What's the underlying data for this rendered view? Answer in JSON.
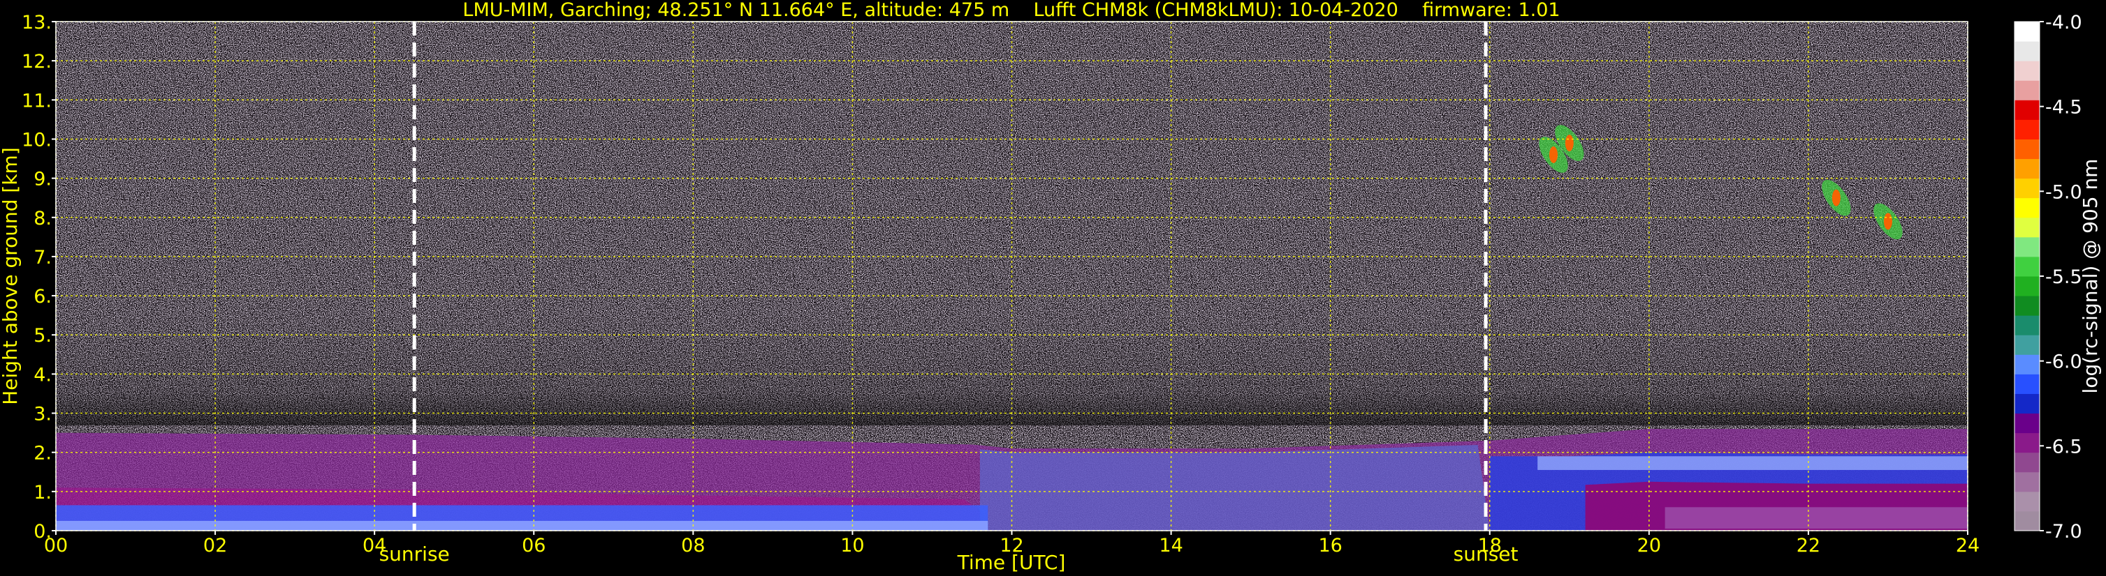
{
  "chart_data": {
    "type": "heatmap",
    "title": "LMU-MIM, Garching; 48.251° N 11.664° E, altitude: 475 m    Lufft CHM8k (CHM8kLMU): 10-04-2020    firmware: 1.01",
    "xlabel": "Time [UTC]",
    "ylabel": "Height above ground [km]",
    "xlim": [
      0,
      24
    ],
    "ylim": [
      0,
      13
    ],
    "x_ticks": [
      "00",
      "02",
      "04",
      "06",
      "08",
      "10",
      "12",
      "14",
      "16",
      "18",
      "20",
      "22",
      "24"
    ],
    "y_ticks": [
      "0.",
      "1.",
      "2.",
      "3.",
      "4.",
      "5.",
      "6.",
      "7.",
      "8.",
      "9.",
      "10.",
      "11.",
      "12.",
      "13."
    ],
    "grid": true,
    "events": [
      {
        "label": "sunrise",
        "time": 4.5
      },
      {
        "label": "sunset",
        "time": 17.95
      }
    ],
    "colorbar": {
      "label": "log(rc-signal) @ 905 nm",
      "range": [
        -7.0,
        -4.0
      ],
      "ticks": [
        "-4.0",
        "-4.5",
        "-5.0",
        "-5.5",
        "-6.0",
        "-6.5",
        "-7.0"
      ],
      "colors": [
        "#a08ca0",
        "#aa90aa",
        "#a070a0",
        "#904890",
        "#8a1a8a",
        "#6a008a",
        "#1428c8",
        "#2850ff",
        "#5a8cff",
        "#40a0a0",
        "#1a8c6c",
        "#108c20",
        "#20b020",
        "#40d040",
        "#80e880",
        "#e0ff40",
        "#ffff00",
        "#ffd000",
        "#ffa000",
        "#ff6000",
        "#ff2000",
        "#e00000",
        "#e8a0a0",
        "#f0d0d0",
        "#e8e8e8",
        "#ffffff"
      ]
    },
    "layers": [
      {
        "name": "boundary-layer-top",
        "x": [
          0,
          4.5,
          8,
          11.5,
          12,
          15,
          18,
          20,
          24
        ],
        "y": [
          2.5,
          2.45,
          2.35,
          2.2,
          2.1,
          2.1,
          2.3,
          2.6,
          2.6
        ]
      },
      {
        "name": "residual-purple",
        "x": [
          0,
          4.5,
          8,
          11.5,
          11.6
        ],
        "y": [
          1.1,
          1.05,
          0.9,
          0.8,
          0.5
        ]
      },
      {
        "name": "night-aerosol",
        "x": [
          19.0,
          20,
          22,
          24
        ],
        "y": [
          1.2,
          1.3,
          1.25,
          1.25
        ]
      }
    ],
    "clouds": [
      {
        "time": 18.8,
        "height": 9.6
      },
      {
        "time": 19.0,
        "height": 9.9
      },
      {
        "time": 22.35,
        "height": 8.5
      },
      {
        "time": 23.0,
        "height": 7.9
      }
    ]
  }
}
